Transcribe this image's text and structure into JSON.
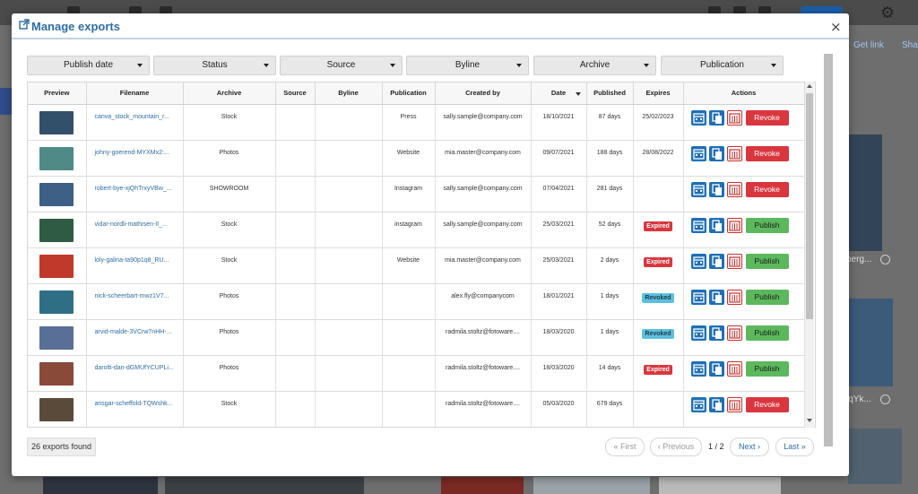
{
  "window": {
    "title": "Manage exports",
    "close_icon": "×"
  },
  "background": {
    "get_link": "Get link",
    "share": "Sha",
    "thumb_text1": "berg...",
    "thumb_text2": "jqYk..."
  },
  "filters": [
    "Publish date",
    "Status",
    "Source",
    "Byline",
    "Archive",
    "Publication"
  ],
  "table": {
    "headers": [
      "Preview",
      "Filename",
      "Archive",
      "Source",
      "Byline",
      "Publication",
      "Created by",
      "Date",
      "Published",
      "Expires",
      "Actions"
    ],
    "rows": [
      {
        "thumb": "#33506a",
        "filename": "canva_stock_mountain_r...",
        "archive": "Stock",
        "source": "",
        "byline": "",
        "publication": "Press",
        "created_by": "sally.sample@company.com",
        "date": "18/10/2021",
        "published": "87 days",
        "expires": "25/02/2023",
        "expires_badge": "",
        "action": "Revoke"
      },
      {
        "thumb": "#4f8a86",
        "filename": "johny-goerend-MYXMx2:...",
        "archive": "Photos",
        "source": "",
        "byline": "",
        "publication": "Website",
        "created_by": "mia.master@company.com",
        "date": "09/07/2021",
        "published": "188 days",
        "expires": "28/08/2022",
        "expires_badge": "",
        "action": "Revoke"
      },
      {
        "thumb": "#3e5f86",
        "filename": "robert-bye-xjQhTrxyVBw_...",
        "archive": "SHOWROOM",
        "source": "",
        "byline": "",
        "publication": "Instagram",
        "created_by": "sally.sample@company.com",
        "date": "07/04/2021",
        "published": "281 days",
        "expires": "",
        "expires_badge": "",
        "action": "Revoke"
      },
      {
        "thumb": "#2f5a44",
        "filename": "vidar-nordli-mathisen-II_...",
        "archive": "Stock",
        "source": "",
        "byline": "",
        "publication": "instagram",
        "created_by": "sally.sample@company.com",
        "date": "25/03/2021",
        "published": "52 days",
        "expires": "",
        "expires_badge": "Expired",
        "action": "Publish"
      },
      {
        "thumb": "#c0392b",
        "filename": "loly-galina-ta90p1q8_RU...",
        "archive": "Stock",
        "source": "",
        "byline": "",
        "publication": "Website",
        "created_by": "mia.master@company.com",
        "date": "25/03/2021",
        "published": "2 days",
        "expires": "",
        "expires_badge": "Expired",
        "action": "Publish"
      },
      {
        "thumb": "#2f6f86",
        "filename": "nick-scheerbart-mwz1V7...",
        "archive": "Photos",
        "source": "",
        "byline": "",
        "publication": "",
        "created_by": "alex.fly@companycom",
        "date": "18/01/2021",
        "published": "1 days",
        "expires": "",
        "expires_badge": "Revoked",
        "action": "Publish"
      },
      {
        "thumb": "#5a6f98",
        "filename": "arvid-malde-3VCrw7nHH-...",
        "archive": "Photos",
        "source": "",
        "byline": "",
        "publication": "",
        "created_by": "radmila.stoltz@fotoware....",
        "date": "18/03/2020",
        "published": "1 days",
        "expires": "",
        "expires_badge": "Revoked",
        "action": "Publish"
      },
      {
        "thumb": "#8a4a3a",
        "filename": "darolti-dan-dGMUfYCUPLi...",
        "archive": "Photos",
        "source": "",
        "byline": "",
        "publication": "",
        "created_by": "radmila.stoltz@fotoware....",
        "date": "18/03/2020",
        "published": "14 days",
        "expires": "",
        "expires_badge": "Expired",
        "action": "Publish"
      },
      {
        "thumb": "#5a4a3a",
        "filename": "ansgar-scheffold-TQWshk...",
        "archive": "Stock",
        "source": "",
        "byline": "",
        "publication": "",
        "created_by": "radmila.stoltz@fotoware....",
        "date": "05/03/2020",
        "published": "679 days",
        "expires": "",
        "expires_badge": "",
        "action": "Revoke"
      }
    ]
  },
  "footer": {
    "found": "26 exports found",
    "first": "« First",
    "previous": "‹ Previous",
    "page": "1 / 2",
    "next": "Next ›",
    "last": "Last »"
  },
  "colors": {
    "accent": "#2e6da4",
    "revoke": "#d9363e",
    "publish": "#5cb85c",
    "revoked_badge": "#5bc0de"
  }
}
